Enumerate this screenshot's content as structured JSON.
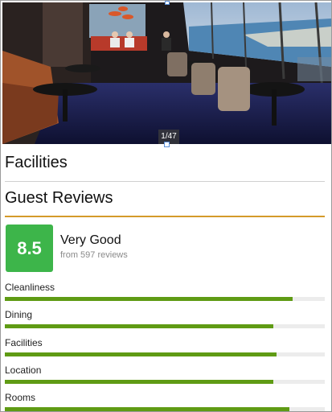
{
  "gallery": {
    "counter": "1/47",
    "photo": "hotel lounge with panoramic city and sea view"
  },
  "facilities": {
    "title": "Facilities"
  },
  "reviews": {
    "title": "Guest Reviews",
    "score": "8.5",
    "rating_word": "Very Good",
    "count_text": "from 597 reviews",
    "score_color": "#3db54a",
    "bar_color": "#5f9b14",
    "categories": [
      {
        "label": "Cleanliness",
        "fraction": 0.9
      },
      {
        "label": "Dining",
        "fraction": 0.84
      },
      {
        "label": "Facilities",
        "fraction": 0.85
      },
      {
        "label": "Location",
        "fraction": 0.84
      },
      {
        "label": "Rooms",
        "fraction": 0.89
      }
    ]
  }
}
